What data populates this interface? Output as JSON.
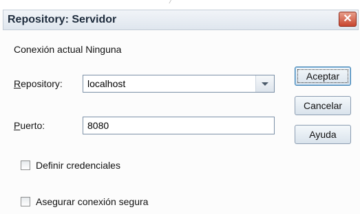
{
  "window": {
    "title": "Repository: Servidor",
    "close_label": "✕"
  },
  "connection": {
    "label": "Conexión actual Ninguna"
  },
  "repository": {
    "label_mnemonic": "R",
    "label_rest": "epository:",
    "value": "localhost",
    "dropdown_icon": "chevron-down-icon"
  },
  "port": {
    "label_mnemonic": "P",
    "label_rest": "uerto:",
    "value": "8080"
  },
  "buttons": {
    "ok": "Aceptar",
    "cancel": "Cancelar",
    "help": "Ayuda"
  },
  "options": {
    "credentials_label": "Definir credenciales",
    "credentials_checked": false,
    "secure_label": "Asegurar conexión segura",
    "secure_checked": false
  },
  "colors": {
    "close_button": "#c8452f",
    "title_text": "#1e2c3d"
  }
}
